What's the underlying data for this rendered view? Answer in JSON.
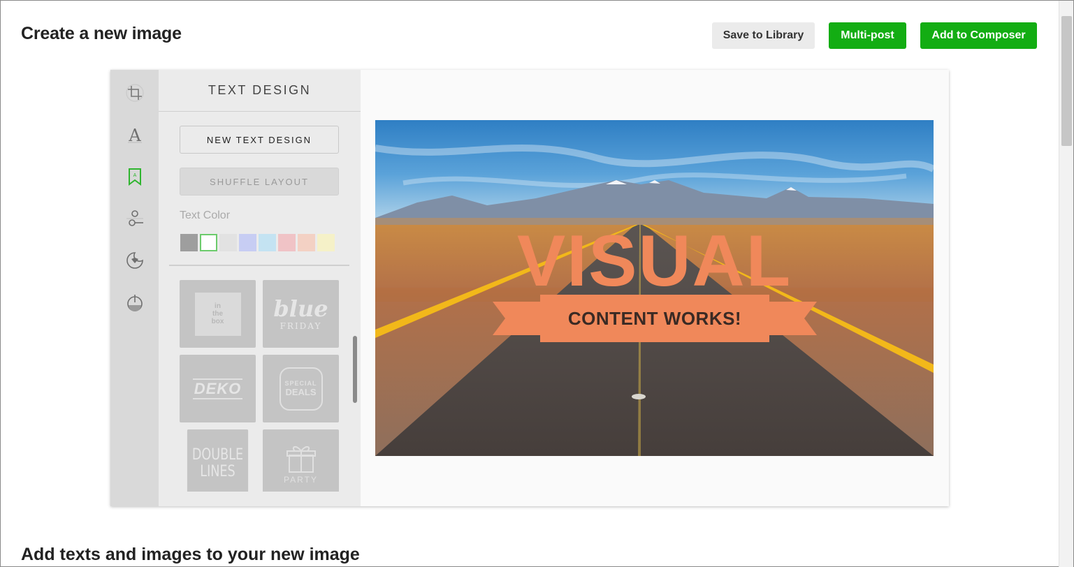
{
  "page": {
    "title": "Create a new image",
    "section_title": "Add texts and images to your new image"
  },
  "actions": {
    "save_label": "Save to Library",
    "multipost_label": "Multi-post",
    "compose_label": "Add to Composer"
  },
  "rail": {
    "icons": [
      "crop-icon",
      "font-icon",
      "text-design-icon",
      "adjust-icon",
      "sticker-icon",
      "filter-icon"
    ],
    "active": "text-design-icon",
    "active_color": "#2fb52f"
  },
  "panel": {
    "title": "TEXT DESIGN",
    "new_button": "NEW TEXT DESIGN",
    "shuffle_button": "SHUFFLE LAYOUT",
    "text_color_label": "Text Color",
    "swatches": [
      "#9e9e9e",
      "#ffffff",
      "#e2e2e2",
      "#c7cdf3",
      "#c4e3f2",
      "#f0c3c6",
      "#f3d1c4",
      "#f5f1c8"
    ],
    "selected_swatch": 1,
    "designs": {
      "box_lines": [
        "in",
        "the",
        "box"
      ],
      "blue_big": "blue",
      "blue_small": "FRIDAY",
      "deko": "DEKO",
      "special_top": "SPECIAL",
      "special_bottom": "DEALS",
      "double_top": "DOUBLE",
      "double_bottom": "LINES",
      "party": "PARTY"
    }
  },
  "canvas": {
    "headline": "VISUAL",
    "subline": "CONTENT WORKS!",
    "accent": "#f0885a"
  }
}
